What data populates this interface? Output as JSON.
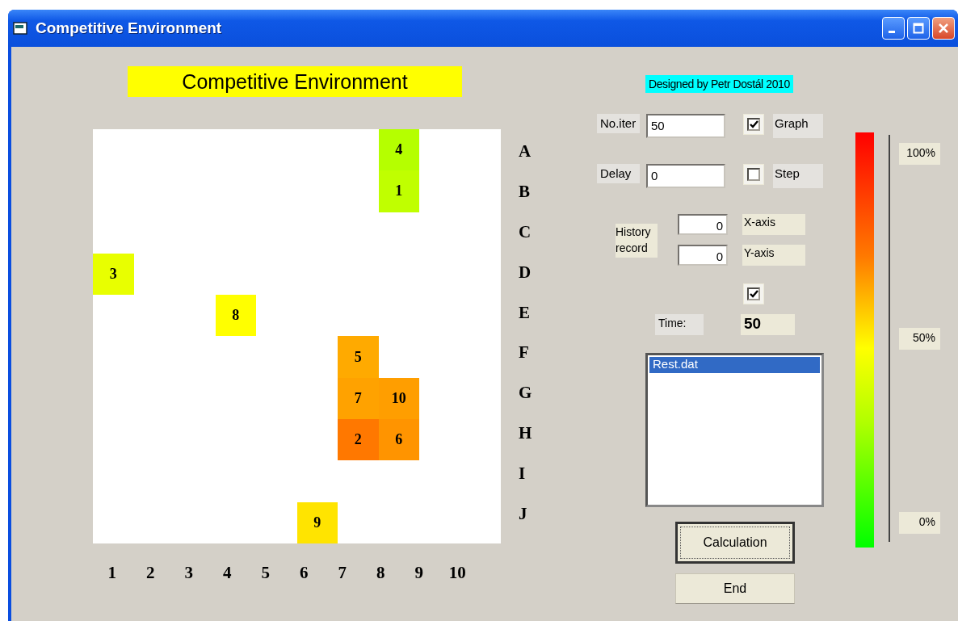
{
  "window": {
    "title": "Competitive Environment"
  },
  "heading": "Competitive Environment",
  "credit": "Designed by Petr Dostál 2010",
  "board": {
    "rows": [
      {
        "label": "A",
        "cells": [
          null,
          null,
          null,
          null,
          null,
          null,
          null,
          {
            "value": "4",
            "color": "#b5ff00"
          },
          null,
          null
        ]
      },
      {
        "label": "B",
        "cells": [
          null,
          null,
          null,
          null,
          null,
          null,
          null,
          {
            "value": "1",
            "color": "#c0ff00"
          },
          null,
          null
        ]
      },
      {
        "label": "C",
        "cells": [
          null,
          null,
          null,
          null,
          null,
          null,
          null,
          null,
          null,
          null
        ]
      },
      {
        "label": "D",
        "cells": [
          {
            "value": "3",
            "color": "#e8ff00"
          },
          null,
          null,
          null,
          null,
          null,
          null,
          null,
          null,
          null
        ]
      },
      {
        "label": "E",
        "cells": [
          null,
          null,
          null,
          {
            "value": "8",
            "color": "#ffff00"
          },
          null,
          null,
          null,
          null,
          null,
          null
        ]
      },
      {
        "label": "F",
        "cells": [
          null,
          null,
          null,
          null,
          null,
          null,
          {
            "value": "5",
            "color": "#ffaa00"
          },
          null,
          null,
          null
        ]
      },
      {
        "label": "G",
        "cells": [
          null,
          null,
          null,
          null,
          null,
          null,
          {
            "value": "7",
            "color": "#ffa200"
          },
          {
            "value": "10",
            "color": "#ff9e00"
          },
          null,
          null
        ]
      },
      {
        "label": "H",
        "cells": [
          null,
          null,
          null,
          null,
          null,
          null,
          {
            "value": "2",
            "color": "#ff7800"
          },
          {
            "value": "6",
            "color": "#ff9400"
          },
          null,
          null
        ]
      },
      {
        "label": "I",
        "cells": [
          null,
          null,
          null,
          null,
          null,
          null,
          null,
          null,
          null,
          null
        ]
      },
      {
        "label": "J",
        "cells": [
          null,
          null,
          null,
          null,
          null,
          {
            "value": "9",
            "color": "#ffe400"
          },
          null,
          null,
          null,
          null
        ]
      }
    ],
    "column_labels": [
      "1",
      "2",
      "3",
      "4",
      "5",
      "6",
      "7",
      "8",
      "9",
      "10"
    ]
  },
  "iterations": {
    "label": "No.iter",
    "value": "50"
  },
  "graph": {
    "label": "Graph",
    "checked": true
  },
  "delay": {
    "label": "Delay",
    "value": "0"
  },
  "step": {
    "label": "Step",
    "checked": false
  },
  "history_record": {
    "label": "History record",
    "x_value": "0",
    "y_value": "0",
    "x_label": "X-axis",
    "y_label": "Y-axis"
  },
  "history_checkbox": {
    "checked": true
  },
  "time": {
    "label": "Time:",
    "value": "50"
  },
  "file_list": [
    {
      "label": "Rest.dat",
      "selected": true
    }
  ],
  "buttons": [
    {
      "label": "Calculation",
      "default": true
    },
    {
      "label": "End",
      "default": false
    }
  ],
  "scale_labels": [
    "100%",
    "50%",
    "0%"
  ]
}
